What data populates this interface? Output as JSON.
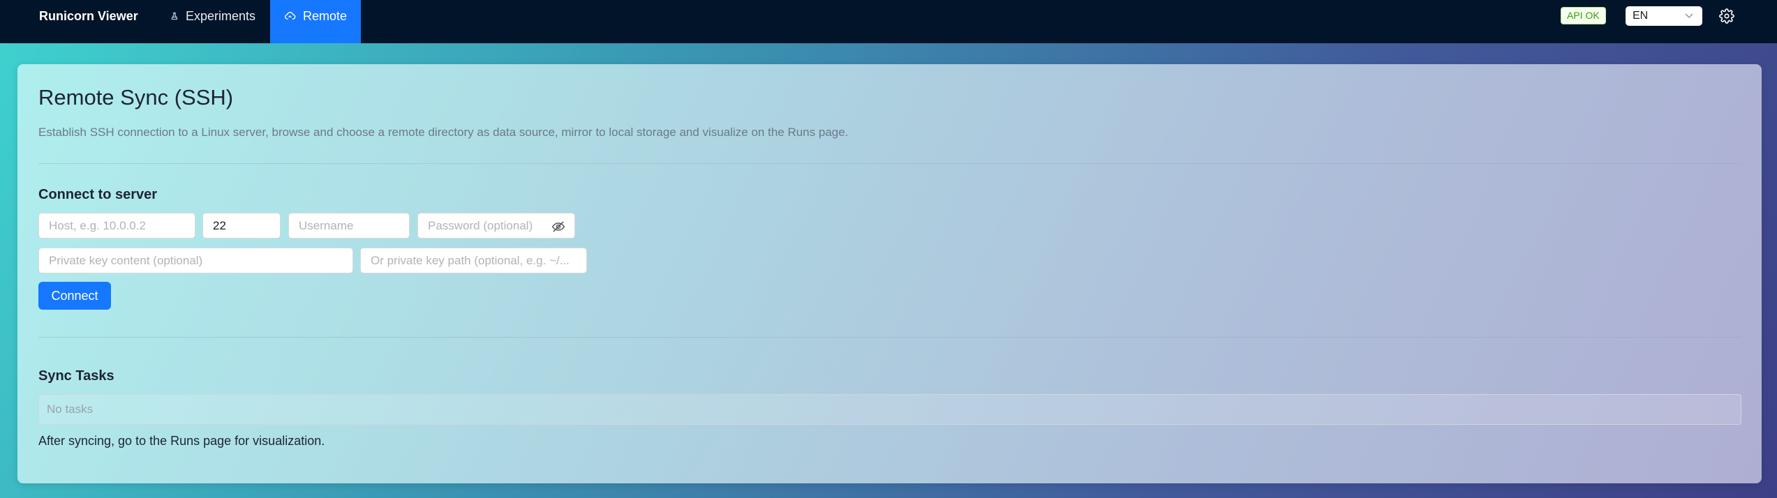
{
  "app": {
    "title": "Runicorn Viewer"
  },
  "nav": {
    "experiments": "Experiments",
    "remote": "Remote"
  },
  "status": {
    "api": "API OK"
  },
  "language": {
    "selected": "EN"
  },
  "page": {
    "title": "Remote Sync (SSH)",
    "subtitle": "Establish SSH connection to a Linux server, browse and choose a remote directory as data source, mirror to local storage and visualize on the Runs page."
  },
  "connect": {
    "section_title": "Connect to server",
    "host_placeholder": "Host, e.g. 10.0.0.2",
    "port_value": "22",
    "username_placeholder": "Username",
    "password_placeholder": "Password (optional)",
    "private_key_placeholder": "Private key content (optional)",
    "key_path_placeholder": "Or private key path (optional, e.g. ~/...",
    "button_label": "Connect"
  },
  "sync": {
    "section_title": "Sync Tasks",
    "empty_text": "No tasks",
    "note": "After syncing, go to the Runs page for visualization."
  },
  "colors": {
    "accent": "#1677ff",
    "topbar": "#021429",
    "status_ok": "#389e0d"
  }
}
